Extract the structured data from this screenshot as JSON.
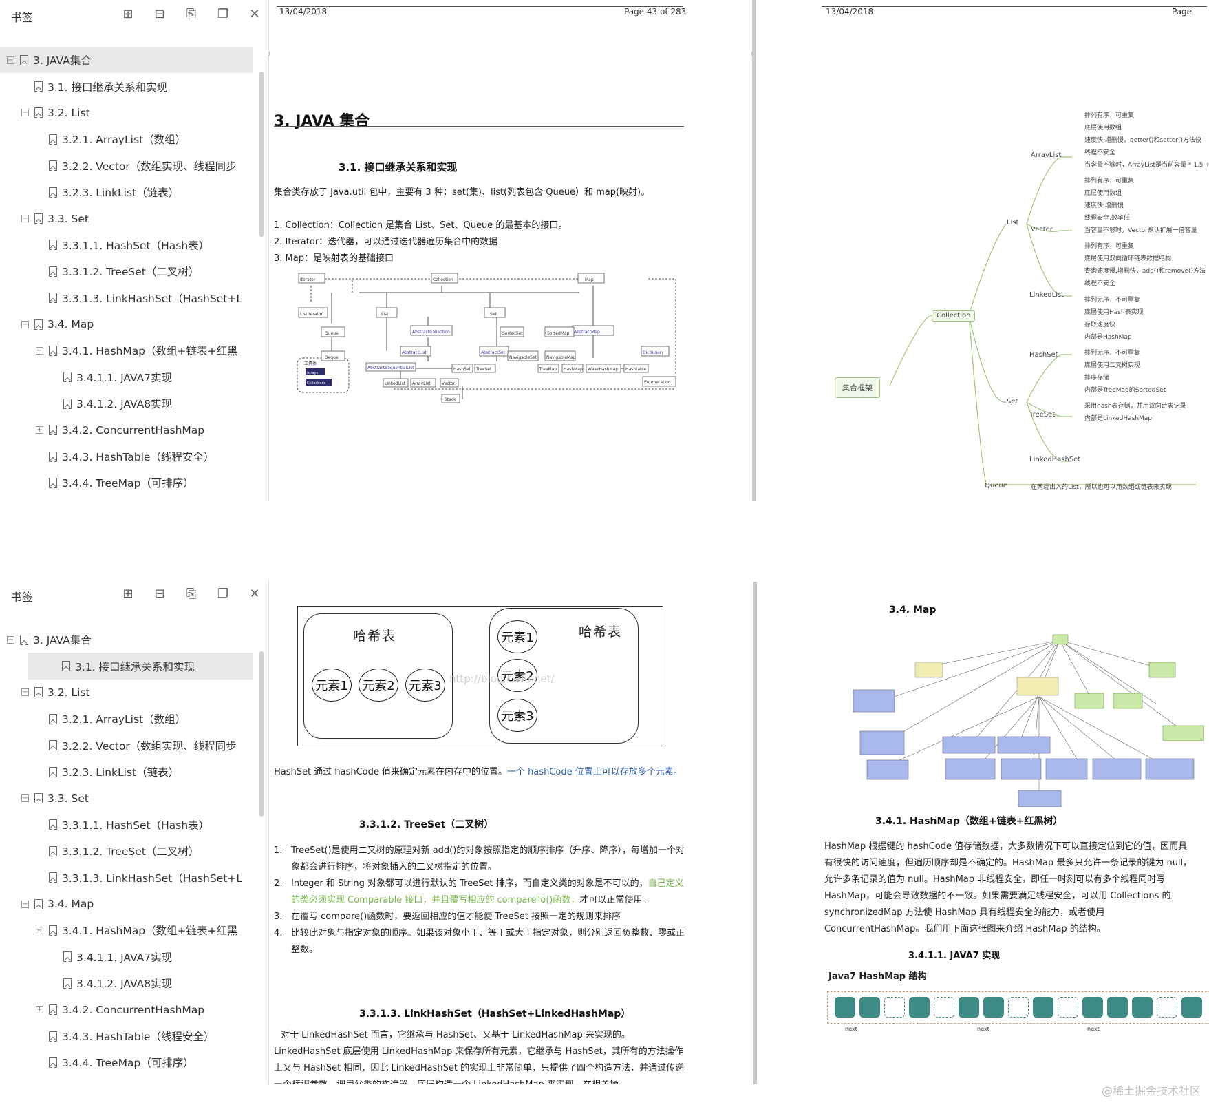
{
  "sidebar": {
    "title": "书签",
    "tree": [
      {
        "label": "3. JAVA集合",
        "level": 0,
        "expander": "−"
      },
      {
        "label": "3.1. 接口继承关系和实现",
        "level": 1,
        "expander": ""
      },
      {
        "label": "3.2. List",
        "level": 1,
        "expander": "−"
      },
      {
        "label": "3.2.1. ArrayList（数组）",
        "level": 2,
        "expander": ""
      },
      {
        "label": "3.2.2. Vector（数组实现、线程同步",
        "level": 2,
        "expander": ""
      },
      {
        "label": "3.2.3. LinkList（链表）",
        "level": 2,
        "expander": ""
      },
      {
        "label": "3.3. Set",
        "level": 1,
        "expander": "−"
      },
      {
        "label": "3.3.1.1. HashSet（Hash表）",
        "level": 2,
        "expander": ""
      },
      {
        "label": "3.3.1.2. TreeSet（二叉树）",
        "level": 2,
        "expander": ""
      },
      {
        "label": "3.3.1.3. LinkHashSet（HashSet+L",
        "level": 2,
        "expander": ""
      },
      {
        "label": "3.4. Map",
        "level": 1,
        "expander": "−"
      },
      {
        "label": "3.4.1. HashMap（数组+链表+红黑",
        "level": 2,
        "expander": "−"
      },
      {
        "label": "3.4.1.1. JAVA7实现",
        "level": 3,
        "expander": ""
      },
      {
        "label": "3.4.1.2. JAVA8实现",
        "level": 3,
        "expander": ""
      },
      {
        "label": "3.4.2. ConcurrentHashMap",
        "level": 2,
        "expander": "+"
      },
      {
        "label": "3.4.3. HashTable（线程安全）",
        "level": 2,
        "expander": ""
      },
      {
        "label": "3.4.4. TreeMap（可排序）",
        "level": 2,
        "expander": ""
      }
    ]
  },
  "top_page1": {
    "date": "13/04/2018",
    "page_num": "Page 43 of 283",
    "title": "3. JAVA 集合",
    "subtitle": "3.1. 接口继承关系和实现",
    "intro": "集合类存放于 Java.util 包中，主要有 3 种：set(集)、list(列表包含 Queue）和 map(映射)。",
    "list": [
      "1.   Collection：Collection 是集合 List、Set、Queue 的最基本的接口。",
      "2.   Iterator：迭代器，可以通过迭代器遍历集合中的数据",
      "3.   Map：是映射表的基础接口"
    ],
    "uml_nodes": [
      "Iterator",
      "Collection",
      "Map",
      "ListIterator",
      "List",
      "Set",
      "AbstractCollection",
      "AbstractMap",
      "Queue",
      "SortedSet",
      "SortedMap",
      "Dictionary",
      "Deque",
      "AbstractList",
      "AbstractSet",
      "NavigableSet",
      "NavigableMap",
      "AbstractSequentialList",
      "HashSet",
      "TreeSet",
      "TreeMap",
      "HashMap",
      "WeakHashMap",
      "Hashtable",
      "LinkedList",
      "ArrayList",
      "Vector",
      "Stack",
      "Enumeration",
      "Arrays",
      "Collections",
      "工具类"
    ]
  },
  "top_page2": {
    "date": "13/04/2018",
    "page_num": "Page",
    "mindmap": {
      "root": "集合框架",
      "collection": "Collection",
      "list": "List",
      "set": "Set",
      "queue": "Queue",
      "queue_note": "在两端出入的List，所以也可以用数组或链表来实现",
      "arraylist": "ArrayList",
      "arraylist_notes": [
        "排列有序，可重复",
        "底层使用数组",
        "速度快,增删慢，getter()和setter()方法快",
        "线程不安全",
        "当容量不够时，ArrayList是当前容量 * 1.5 +"
      ],
      "vector": "Vector",
      "vector_notes": [
        "排列有序，可重复",
        "底层使用数组",
        "速度快,增删慢",
        "线程安全,效率低",
        "当容量不够时，Vector默认扩展一倍容量"
      ],
      "linkedlist": "LinkedList",
      "linkedlist_notes": [
        "排列有序，可重复",
        "底层使用双向循环链表数据结构",
        "查询速度慢,增删快，add()和remove()方法",
        "线程不安全"
      ],
      "hashset": "HashSet",
      "hashset_notes": [
        "排列无序，不可重复",
        "底层使用Hash表实现",
        "存取速度快",
        "内部是HashMap"
      ],
      "treeset": "TreeSet",
      "treeset_notes": [
        "排列无序，不可重复",
        "底层使用二叉树实现",
        "排序存储",
        "内部是TreeMap的SortedSet"
      ],
      "linkedhashset": "LinkedHashSet",
      "linkedhashset_notes": [
        "采用hash表存储，并用双向链表记录",
        "内部是LinkedHashMap"
      ]
    }
  },
  "bottom_page1": {
    "hash_left_title": "哈希表",
    "hash_right_title": "哈希表",
    "elements": [
      "元素1",
      "元素2",
      "元素3"
    ],
    "watermark_url": "http://blog.csdn.net/",
    "hash_text": "HashSet 通过 hashCode 值来确定元素在内存中的位置。",
    "hash_link": "一个 hashCode 位置上可以存放多个元素。",
    "treeset_title": "3.3.1.2.      TreeSet（二叉树）",
    "treeset_items": [
      {
        "num": "1.",
        "text": "TreeSet()是使用二叉树的原理对新 add()的对象按照指定的顺序排序（升序、降序），每增加一个对象都会进行排序，将对象插入的二叉树指定的位置。"
      },
      {
        "num": "2.",
        "text_a": "Integer 和 String 对象都可以进行默认的 TreeSet 排序，而自定义类的对象是不可以的，",
        "text_green": "自己定义的类必须实现 Comparable 接口，并且覆写相应的 compareTo()函数，",
        "text_b": "才可以正常使用。"
      },
      {
        "num": "3.",
        "text": "在覆写 compare()函数时，要返回相应的值才能使 TreeSet 按照一定的规则来排序"
      },
      {
        "num": "4.",
        "text": "比较此对象与指定对象的顺序。如果该对象小于、等于或大于指定对象，则分别返回负整数、零或正整数。"
      }
    ],
    "linkhash_title": "3.3.1.3.      LinkHashSet（HashSet+LinkedHashMap）",
    "linkhash_text": "对于 LinkedHashSet 而言，它继承与 HashSet、又基于 LinkedHashMap 来实现的。LinkedHashSet 底层使用 LinkedHashMap 来保存所有元素，它继承与 HashSet，其所有的方法操作上又与 HashSet 相同，因此 LinkedHashSet 的实现上非常简单，只提供了四个构造方法，并通过传递一个标识参数，调用父类的构造器，底层构造一个 LinkedHashMap 来实现，在相关操"
  },
  "bottom_page2": {
    "map_title": "3.4. Map",
    "hashmap_title": "3.4.1.  HashMap（数组+链表+红黑树）",
    "hashmap_text": "HashMap 根据键的 hashCode 值存储数据，大多数情况下可以直接定位到它的值，因而具有很快的访问速度，但遍历顺序却是不确定的。HashMap 最多只允许一条记录的键为 null，允许多条记录的值为 null。HashMap 非线程安全，即任一时刻可以有多个线程同时写 HashMap，可能会导致数据的不一致。如果需要满足线程安全，可以用 Collections 的 synchronizedMap 方法使 HashMap 具有线程安全的能力，或者使用 ConcurrentHashMap。我们用下面这张图来介绍 HashMap 的结构。",
    "java7_title": "3.4.1.1.      JAVA7 实现",
    "java7_sub": "Java7 HashMap 结构",
    "next_label": "next",
    "bucket_color": "#3d8b85"
  },
  "watermark": "@稀土掘金技术社区"
}
